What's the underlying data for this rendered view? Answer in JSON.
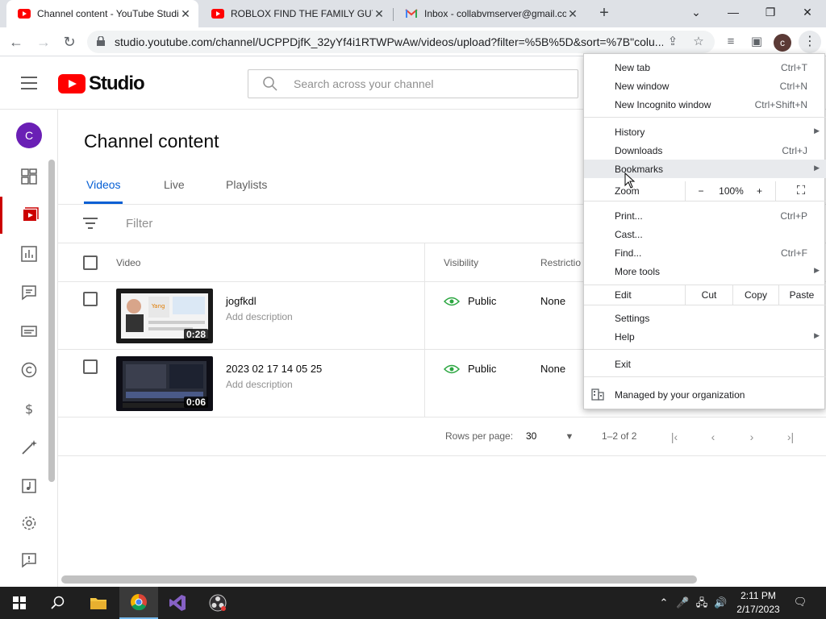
{
  "browser": {
    "tabs": [
      {
        "title": "Channel content - YouTube Studio",
        "active": true
      },
      {
        "title": "ROBLOX FIND THE FAMILY GUY...",
        "active": false
      },
      {
        "title": "Inbox - collabvmserver@gmail.com",
        "active": false
      }
    ],
    "url": "studio.youtube.com/channel/UCPPDjfK_32yYf4i1RTWPwAw/videos/upload?filter=%5B%5D&sort=%7B\"colu...",
    "profile_initial": "c"
  },
  "studio": {
    "logo_text": "Studio",
    "search_placeholder": "Search across your channel",
    "avatar_initial": "C",
    "page_title": "Channel content",
    "tabs": [
      "Videos",
      "Live",
      "Playlists"
    ],
    "filter_label": "Filter",
    "columns": {
      "video": "Video",
      "visibility": "Visibility",
      "restrictions": "Restrictio"
    },
    "videos": [
      {
        "title": "jogfkdl",
        "description": "Add description",
        "duration": "0:28",
        "visibility": "Public",
        "restrictions": "None"
      },
      {
        "title": "2023 02 17 14 05 25",
        "description": "Add description",
        "duration": "0:06",
        "visibility": "Public",
        "restrictions": "None"
      }
    ],
    "pager": {
      "rows_label": "Rows per page:",
      "rows_value": "30",
      "range": "1–2 of 2"
    }
  },
  "chrome_menu": {
    "new_tab": {
      "label": "New tab",
      "shortcut": "Ctrl+T"
    },
    "new_window": {
      "label": "New window",
      "shortcut": "Ctrl+N"
    },
    "incognito": {
      "label": "New Incognito window",
      "shortcut": "Ctrl+Shift+N"
    },
    "history": {
      "label": "History"
    },
    "downloads": {
      "label": "Downloads",
      "shortcut": "Ctrl+J"
    },
    "bookmarks": {
      "label": "Bookmarks"
    },
    "zoom": {
      "label": "Zoom",
      "minus": "−",
      "value": "100%",
      "plus": "+"
    },
    "print": {
      "label": "Print...",
      "shortcut": "Ctrl+P"
    },
    "cast": {
      "label": "Cast..."
    },
    "find": {
      "label": "Find...",
      "shortcut": "Ctrl+F"
    },
    "more_tools": {
      "label": "More tools"
    },
    "edit": {
      "label": "Edit",
      "cut": "Cut",
      "copy": "Copy",
      "paste": "Paste"
    },
    "settings": {
      "label": "Settings"
    },
    "help": {
      "label": "Help"
    },
    "exit": {
      "label": "Exit"
    },
    "managed": {
      "label": "Managed by your organization"
    }
  },
  "taskbar": {
    "time": "2:11 PM",
    "date": "2/17/2023"
  },
  "colors": {
    "youtube_red": "#ff0000",
    "accent_blue": "#065fd4",
    "avatar_purple": "#6a1fb5"
  }
}
